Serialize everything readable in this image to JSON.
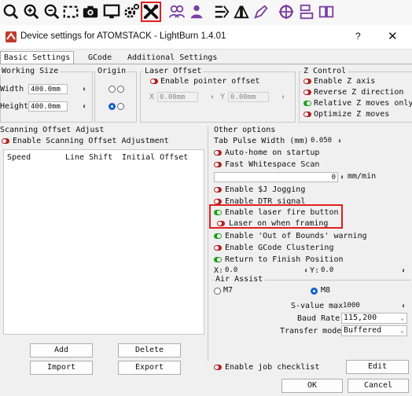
{
  "window": {
    "title": "Device settings for ATOMSTACK - LightBurn 1.4.01",
    "help": "?",
    "close": "✕"
  },
  "tabs": [
    "Basic Settings",
    "GCode",
    "Additional Settings"
  ],
  "working_size": {
    "title": "Working Size",
    "width_label": "Width",
    "width_value": "400.0mm",
    "height_label": "Height",
    "height_value": "400.0mm"
  },
  "origin": {
    "title": "Origin",
    "selected": "bottom-left"
  },
  "laser_offset": {
    "title": "Laser Offset",
    "enable_label": "Enable pointer offset",
    "x_label": "X",
    "x_value": "0.00mm",
    "y_label": "Y",
    "y_value": "0.00mm"
  },
  "z_control": {
    "title": "Z Control",
    "items": [
      {
        "label": "Enable Z axis",
        "on": false
      },
      {
        "label": "Reverse Z direction",
        "on": false
      },
      {
        "label": "Relative Z moves only",
        "on": true
      },
      {
        "label": "Optimize Z moves",
        "on": false
      }
    ]
  },
  "scanning": {
    "title": "Scanning Offset Adjust",
    "enable_label": "Enable Scanning Offset Adjustment",
    "columns": [
      "Speed",
      "Line Shift",
      "Initial Offset"
    ],
    "add": "Add",
    "delete": "Delete",
    "import": "Import",
    "export": "Export"
  },
  "other": {
    "title": "Other options",
    "tab_pulse_label": "Tab Pulse Width (mm)",
    "tab_pulse_value": "0.050",
    "auto_home": "Auto-home on startup",
    "fast_whitespace": "Fast Whitespace Scan",
    "whitespace_value": "0",
    "whitespace_unit": "mm/min",
    "enable_j": "Enable $J Jogging",
    "enable_dtr": "Enable DTR signal",
    "enable_fire": "Enable laser fire button",
    "laser_on_framing": "Laser on when framing",
    "out_of_bounds": "Enable 'Out of Bounds' warning",
    "gcode_clustering": "Enable GCode Clustering",
    "return_finish": "Return to Finish Position",
    "x_label": "X:",
    "x_value": "0.0",
    "y_label": "Y:",
    "y_value": "0.0",
    "air_assist_title": "Air Assist",
    "m7": "M7",
    "m8": "M8",
    "s_value_label": "S-value max",
    "s_value": "1000",
    "baud_label": "Baud Rate",
    "baud_value": "115,200",
    "transfer_label": "Transfer mode",
    "transfer_value": "Buffered"
  },
  "footer": {
    "job_checklist": "Enable job checklist",
    "edit": "Edit",
    "ok": "OK",
    "cancel": "Cancel"
  },
  "colors": {
    "toggle_on": "#1ca01c",
    "toggle_off": "#b22020",
    "highlight": "#e02020",
    "radio_selected": "#1060d0"
  }
}
